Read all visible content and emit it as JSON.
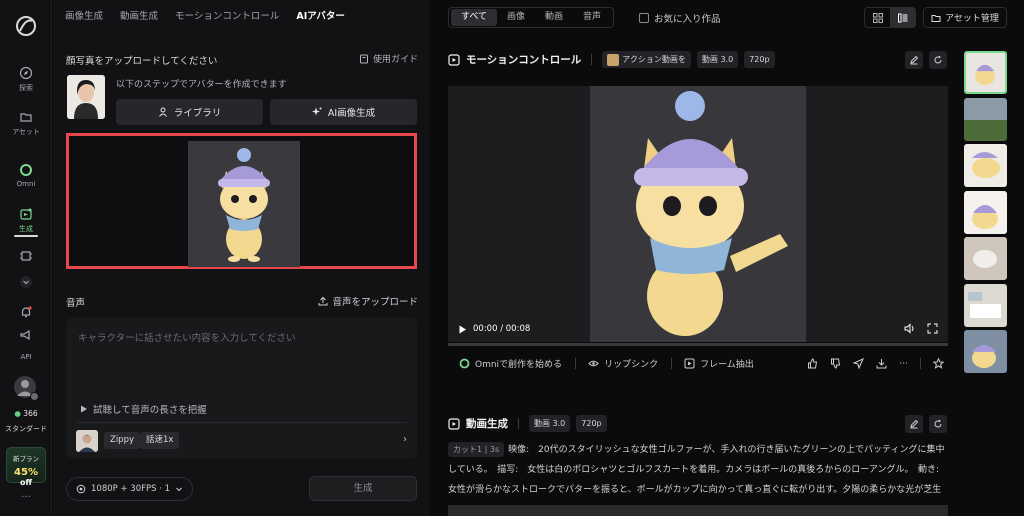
{
  "rail": {
    "items": [
      {
        "label": "探索",
        "icon": "explore-icon"
      },
      {
        "label": "アセット",
        "icon": "folder-icon"
      },
      {
        "label": "Omni",
        "icon": "omni-icon"
      },
      {
        "label": "生成",
        "icon": "generate-icon"
      },
      {
        "label": "API",
        "icon": "api-icon"
      }
    ],
    "credits": "366",
    "plan": "スタンダード",
    "promo_line1": "新プラン",
    "promo_pct": "45%",
    "promo_off": "off"
  },
  "left": {
    "tabs": [
      "画像生成",
      "動画生成",
      "モーションコントロール",
      "AIアバター"
    ],
    "active_tab": "AIアバター",
    "upload_title": "顔写真をアップロードしてください",
    "guide": "使用ガイド",
    "steps_text": "以下のステップでアバターを作成できます",
    "library_btn": "ライブラリ",
    "ai_image_btn": "AI画像生成",
    "audio_title": "音声",
    "audio_upload": "音声をアップロード",
    "textarea_placeholder": "キャラクターに話させたい内容を入力してください",
    "listen_text": "試聴して音声の長さを把握",
    "voice_name": "Zippy",
    "voice_speed": "話速1x",
    "resolution": "1080P + 30FPS · 1",
    "generate_btn": "生成"
  },
  "right": {
    "filters": [
      "すべて",
      "画像",
      "動画",
      "音声"
    ],
    "active_filter": "すべて",
    "favorites": "お気に入り作品",
    "asset_mgmt": "アセット管理",
    "card1": {
      "title": "モーションコントロール",
      "tag1": "アクション動画を",
      "tag2": "動画 3.0",
      "tag3": "720p",
      "time": "00:00 / 00:08",
      "progress": 0,
      "actions": [
        "Omniで創作を始める",
        "リップシンク",
        "フレーム抽出"
      ]
    },
    "card2": {
      "title": "動画生成",
      "tag2": "動画 3.0",
      "tag3": "720p",
      "cut": "カット1",
      "duration": "3s",
      "desc_line1": "映像:　20代のスタイリッシュな女性ゴルファーが、手入れの行き届いたグリーンの上でパッティングに集中",
      "desc_line2": "している。　描写:　女性は白のポロシャツとゴルフスカートを着用。カメラはボールの真後ろからのローアングル。　動き:",
      "desc_line3": "女性が滑らかなストロークでパターを振ると、ボールがカップに向かって真っ直ぐに転がり出す。夕陽の柔らかな光が芝生"
    }
  },
  "colors": {
    "accent": "#7bd88f",
    "alert": "#e5484d",
    "bg": "#0b0b0c",
    "panel": "#121214"
  }
}
